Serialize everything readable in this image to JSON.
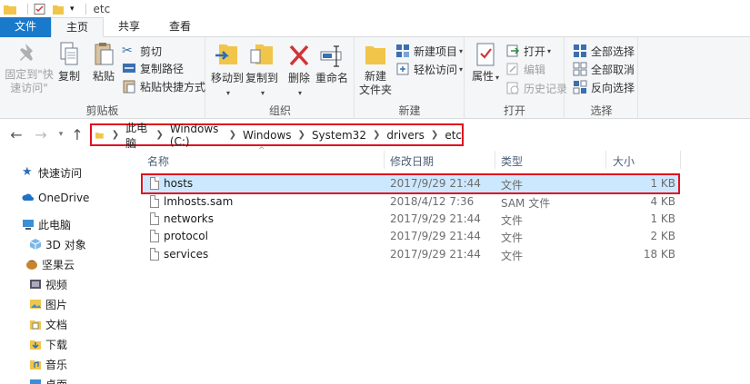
{
  "titlebar": {
    "title": "etc"
  },
  "tabs": [
    {
      "label": "文件"
    },
    {
      "label": "主页"
    },
    {
      "label": "共享"
    },
    {
      "label": "查看"
    }
  ],
  "ribbon": {
    "clipboard": {
      "group_label": "剪贴板",
      "pin_label_1": "固定到\"快",
      "pin_label_2": "速访问\"",
      "copy": "复制",
      "paste": "粘贴",
      "cut": "剪切",
      "copy_path": "复制路径",
      "paste_shortcut": "粘贴快捷方式"
    },
    "organize": {
      "group_label": "组织",
      "move_to": "移动到",
      "copy_to": "复制到",
      "delete": "删除",
      "rename": "重命名"
    },
    "new": {
      "group_label": "新建",
      "new_folder_1": "新建",
      "new_folder_2": "文件夹",
      "new_item": "新建项目",
      "easy_access": "轻松访问"
    },
    "open": {
      "group_label": "打开",
      "properties": "属性",
      "open": "打开",
      "edit": "编辑",
      "history": "历史记录"
    },
    "select": {
      "group_label": "选择",
      "select_all": "全部选择",
      "select_none": "全部取消",
      "invert": "反向选择"
    }
  },
  "address": {
    "crumbs": [
      "此电脑",
      "Windows (C:)",
      "Windows",
      "System32",
      "drivers",
      "etc"
    ]
  },
  "navpane": {
    "items": [
      {
        "label": "快速访问",
        "icon": "star-icon"
      },
      {
        "label": "OneDrive",
        "icon": "cloud-icon"
      },
      {
        "label": "此电脑",
        "icon": "computer-icon"
      },
      {
        "label": "3D 对象",
        "icon": "cube-icon"
      },
      {
        "label": "坚果云",
        "icon": "nut-icon"
      },
      {
        "label": "视频",
        "icon": "video-icon"
      },
      {
        "label": "图片",
        "icon": "picture-icon"
      },
      {
        "label": "文档",
        "icon": "document-icon"
      },
      {
        "label": "下载",
        "icon": "download-icon"
      },
      {
        "label": "音乐",
        "icon": "music-icon"
      },
      {
        "label": "桌面",
        "icon": "desktop-icon"
      }
    ]
  },
  "columns": {
    "name": "名称",
    "date": "修改日期",
    "type": "类型",
    "size": "大小"
  },
  "files": [
    {
      "name": "hosts",
      "date": "2017/9/29 21:44",
      "type": "文件",
      "size": "1 KB"
    },
    {
      "name": "lmhosts.sam",
      "date": "2018/4/12 7:36",
      "type": "SAM 文件",
      "size": "4 KB"
    },
    {
      "name": "networks",
      "date": "2017/9/29 21:44",
      "type": "文件",
      "size": "1 KB"
    },
    {
      "name": "protocol",
      "date": "2017/9/29 21:44",
      "type": "文件",
      "size": "2 KB"
    },
    {
      "name": "services",
      "date": "2017/9/29 21:44",
      "type": "文件",
      "size": "18 KB"
    }
  ],
  "colors": {
    "accent": "#1979ca",
    "highlight": "#e0101f",
    "selection": "#cce8ff"
  }
}
